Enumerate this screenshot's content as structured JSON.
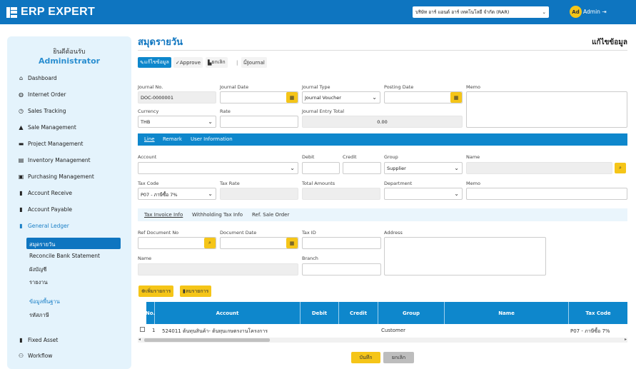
{
  "header": {
    "brand": "ERP EXPERT",
    "company": "บริษัท อาร์ แอนด์ อาร์ เทคโนโลยี จำกัด (RAR)",
    "avatar": "Ad",
    "user": "Admin"
  },
  "sidebar": {
    "welcome": "ยินดีต้อนรับ",
    "name": "Administrator",
    "items": [
      {
        "label": "Dashboard",
        "icon": "home-icon"
      },
      {
        "label": "Internet Order",
        "icon": "globe-icon"
      },
      {
        "label": "Sales Tracking",
        "icon": "clock-icon"
      },
      {
        "label": "Sale Management",
        "icon": "building-icon"
      },
      {
        "label": "Project Management",
        "icon": "briefcase-icon"
      },
      {
        "label": "Inventory Management",
        "icon": "warehouse-icon"
      },
      {
        "label": "Purchasing Management",
        "icon": "cart-icon"
      },
      {
        "label": "Account Receive",
        "icon": "file-icon"
      },
      {
        "label": "Account Payable",
        "icon": "file-icon"
      },
      {
        "label": "General Ledger",
        "icon": "file-icon"
      }
    ],
    "gl_sub": [
      "สมุดรายวัน",
      "Reconcile Bank Statement",
      "ผังบัญชี",
      "รายงาน"
    ],
    "master_title": "ข้อมูลพื้นฐาน",
    "master_sub": [
      "รหัสภาษี"
    ],
    "bottom": [
      {
        "label": "Fixed Asset",
        "icon": "file-icon"
      },
      {
        "label": "Workflow",
        "icon": "sitemap-icon"
      }
    ]
  },
  "page": {
    "title": "สมุดรายวัน",
    "mode": "แก้ไขข้อมูล"
  },
  "toolbar": {
    "edit": "แก้ไขข้อมูล",
    "approve": "Approve",
    "cancel": "ยกเลิก",
    "journal": "Journal"
  },
  "form": {
    "journal_no_label": "Journal No.",
    "journal_no": "DOC-0000001",
    "journal_date_label": "Journal Date",
    "journal_type_label": "Journal Type",
    "journal_type": "Journal Voucher",
    "posting_date_label": "Posting Date",
    "memo_label": "Memo",
    "currency_label": "Currency",
    "currency": "THB",
    "rate_label": "Rate",
    "total_label": "Journal Entry Total",
    "total": "0.00"
  },
  "tabs": {
    "line": "Line",
    "remark": "Remark",
    "user_info": "User Information"
  },
  "line": {
    "account_label": "Account",
    "debit_label": "Debit",
    "credit_label": "Credit",
    "group_label": "Group",
    "group": "Supplier",
    "name_label": "Name",
    "taxcode_label": "Tax Code",
    "taxcode": "P07 - ภาษีซื้อ 7%",
    "taxrate_label": "Tax Rate",
    "totalamt_label": "Total Amounts",
    "dept_label": "Department",
    "memo_label": "Memo"
  },
  "subtabs": {
    "tax_invoice": "Tax Invoice Info",
    "withholding": "Withholding Tax Info",
    "ref_so": "Ref. Sale Order"
  },
  "tax": {
    "refdoc_label": "Ref Document No",
    "docdate_label": "Document Date",
    "taxid_label": "Tax ID",
    "address_label": "Address",
    "name_label": "Name",
    "branch_label": "Branch"
  },
  "buttons": {
    "add": "เพิ่มรายการ",
    "delete": "ลบรายการ",
    "save": "บันทึก",
    "cancel": "ยกเลิก"
  },
  "table": {
    "headers": [
      "No.",
      "Account",
      "Debit",
      "Credit",
      "Group",
      "Name",
      "Tax Code"
    ],
    "rows": [
      {
        "no": "1",
        "account": "524011 ต้นทุนสินค้า- ต้นทุนเกษตรงานโครงการ",
        "debit": "",
        "credit": "",
        "group": "Customer",
        "name": "",
        "taxcode": "P07 - ภาษีซื้อ 7%"
      }
    ]
  }
}
